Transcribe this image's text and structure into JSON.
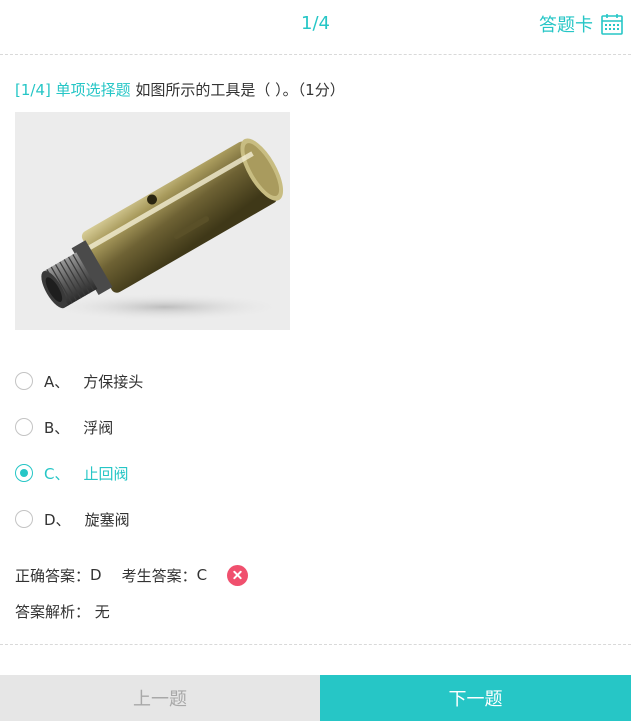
{
  "header": {
    "progress": "1/4",
    "answer_card_label": "答题卡",
    "answer_card_icon": "calendar-icon"
  },
  "question": {
    "tag": "[1/4] 单项选择题",
    "text": "如图所示的工具是（ ）。（1分）"
  },
  "figure": {
    "description_icon": "valve-product-image"
  },
  "options": [
    {
      "letter": "A、",
      "text": "方保接头",
      "selected": false
    },
    {
      "letter": "B、",
      "text": "浮阀",
      "selected": false
    },
    {
      "letter": "C、",
      "text": "止回阀",
      "selected": true
    },
    {
      "letter": "D、",
      "text": "旋塞阀",
      "selected": false
    }
  ],
  "result": {
    "correct_label": "正确答案：",
    "correct_value": "D",
    "student_label": "考生答案：",
    "student_value": "C",
    "status_icon": "wrong-icon"
  },
  "analysis": {
    "label": "答案解析：",
    "value": "无"
  },
  "footer": {
    "prev_label": "上一题",
    "next_label": "下一题"
  },
  "colors": {
    "accent": "#26c6c6",
    "wrong": "#f0506e",
    "prev_bg": "#e6e6e6"
  }
}
